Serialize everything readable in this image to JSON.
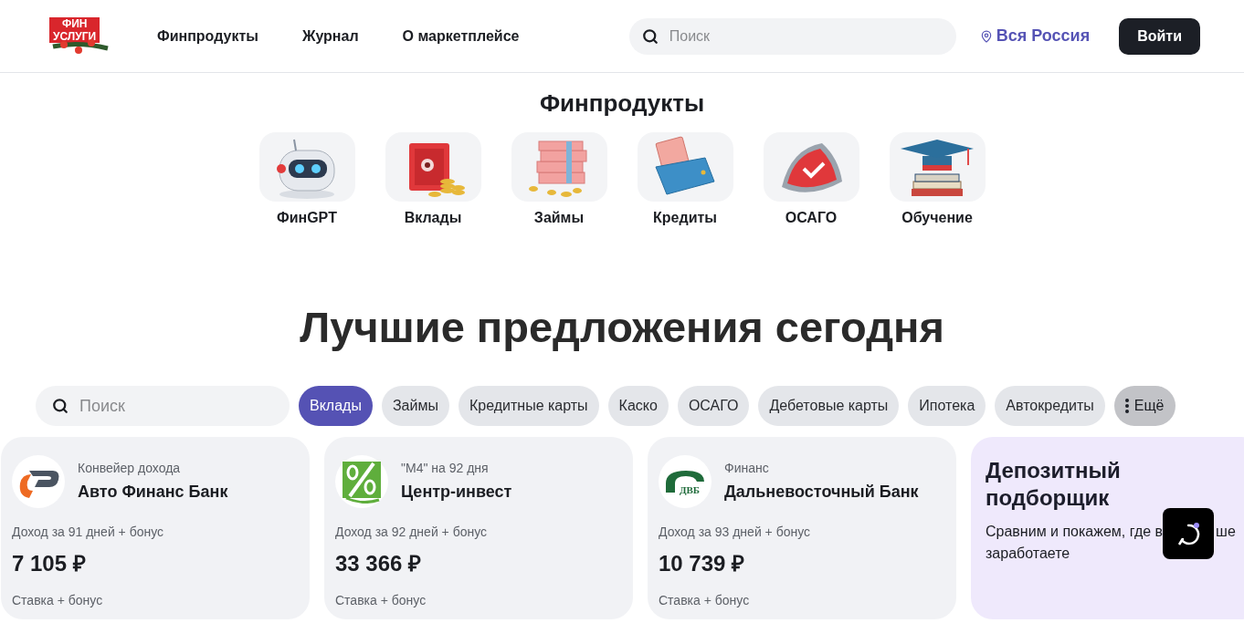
{
  "header": {
    "logo": {
      "lines": [
        "ФИН",
        "УСЛУГИ"
      ]
    },
    "nav": [
      {
        "label": "Финпродукты"
      },
      {
        "label": "Журнал"
      },
      {
        "label": "О маркетплейсе"
      }
    ],
    "search": {
      "placeholder": "Поиск"
    },
    "region": "Вся Россия",
    "login": "Войти"
  },
  "products": {
    "title": "Финпродукты",
    "items": [
      {
        "label": "ФинGPT",
        "kind": "robot"
      },
      {
        "label": "Вклады",
        "kind": "safe"
      },
      {
        "label": "Займы",
        "kind": "cash"
      },
      {
        "label": "Кредиты",
        "kind": "wallet"
      },
      {
        "label": "ОСАГО",
        "kind": "shield"
      },
      {
        "label": "Обучение",
        "kind": "cap"
      }
    ]
  },
  "offers": {
    "title": "Лучшие предложения сегодня",
    "search": {
      "placeholder": "Поиск"
    },
    "filters": [
      {
        "label": "Вклады",
        "selected": true
      },
      {
        "label": "Займы",
        "selected": false
      },
      {
        "label": "Кредитные карты",
        "selected": false
      },
      {
        "label": "Каско",
        "selected": false
      },
      {
        "label": "ОСАГО",
        "selected": false
      },
      {
        "label": "Дебетовые карты",
        "selected": false
      },
      {
        "label": "Ипотека",
        "selected": false
      },
      {
        "label": "Автокредиты",
        "selected": false
      }
    ],
    "more": "Ещё",
    "cards": [
      {
        "kind": "swoosh",
        "product": "Конвейер дохода",
        "bank": "Авто Финанс Банк",
        "income_label": "Доход за 91 дней + бонус",
        "income": "7 105 ₽",
        "rate_label": "Ставка + бонус"
      },
      {
        "kind": "percent",
        "product": "\"М4\" на 92 дня",
        "bank": "Центр-инвест",
        "income_label": "Доход за 92 дней + бонус",
        "income": "33 366 ₽",
        "rate_label": "Ставка + бонус"
      },
      {
        "kind": "arch",
        "logo_text": "ДВБ",
        "product": "Финанс",
        "bank": "Дальневосточный Банк",
        "income_label": "Доход за 93 дней + бонус",
        "income": "10 739 ₽",
        "rate_label": "Ставка + бонус"
      }
    ],
    "promo": {
      "title": "Депозитный подборщик",
      "description_parts": [
        "Сравним и покажем, где в",
        "ше",
        "заработаете"
      ]
    }
  }
}
